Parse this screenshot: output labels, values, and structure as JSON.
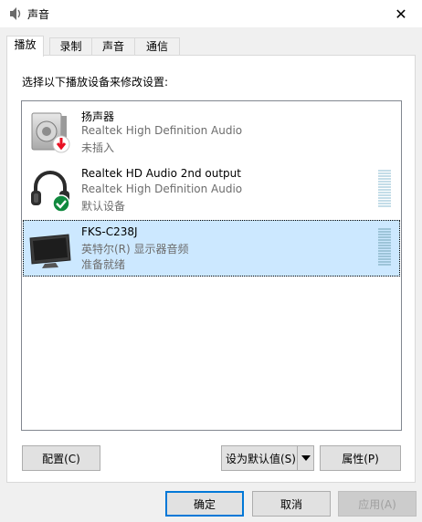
{
  "window": {
    "title": "声音",
    "close_glyph": "✕"
  },
  "tabs": [
    {
      "label": "播放",
      "active": true
    },
    {
      "label": "录制",
      "active": false
    },
    {
      "label": "声音",
      "active": false
    },
    {
      "label": "通信",
      "active": false
    }
  ],
  "instruction": "选择以下播放设备来修改设置:",
  "devices": [
    {
      "name": "扬声器",
      "description": "Realtek High Definition Audio",
      "status": "未插入",
      "icon": "speaker-icon",
      "badge": "unplugged-badge",
      "selected": false
    },
    {
      "name": "Realtek HD Audio 2nd output",
      "description": "Realtek High Definition Audio",
      "status": "默认设备",
      "icon": "headphones-icon",
      "badge": "default-check-badge",
      "selected": false
    },
    {
      "name": "FKS-C238J",
      "description": "英特尔(R) 显示器音频",
      "status": "准备就绪",
      "icon": "monitor-icon",
      "badge": "",
      "selected": true
    }
  ],
  "panel_buttons": {
    "configure": "配置(C)",
    "set_default": "设为默认值(S)",
    "properties": "属性(P)"
  },
  "dialog_buttons": {
    "ok": "确定",
    "cancel": "取消",
    "apply": "应用(A)"
  },
  "colors": {
    "selection": "#cce8ff",
    "accent": "#0078d7",
    "check_green": "#10893e",
    "unplugged_red": "#e81123"
  }
}
